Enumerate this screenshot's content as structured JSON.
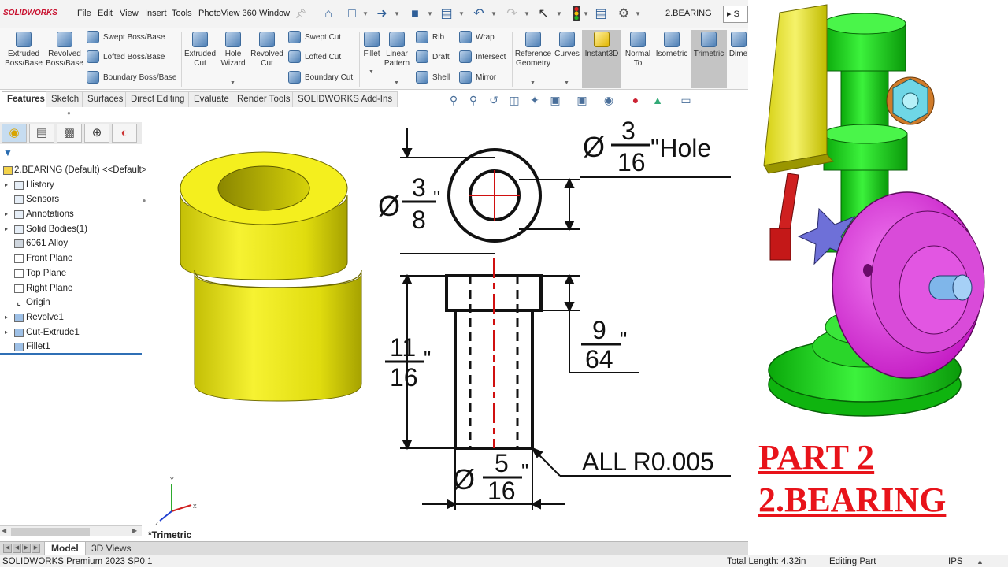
{
  "app": {
    "logo_text": "SOLIDWORKS",
    "menu": [
      "File",
      "Edit",
      "View",
      "Insert",
      "Tools",
      "PhotoView 360",
      "Window"
    ],
    "pin_icon": "pin-icon",
    "document_title": "2.BEARING",
    "search_text": "S",
    "quick_access_icons": [
      "home-icon",
      "new-document-icon",
      "open-icon",
      "save-icon",
      "print-icon",
      "undo-icon",
      "redo-icon",
      "select-icon",
      "rebuild-icon",
      "file-properties-icon",
      "options-icon"
    ]
  },
  "ribbon": {
    "extruded_boss": "Extruded\nBoss/Base",
    "revolved_boss": "Revolved\nBoss/Base",
    "swept_boss": "Swept Boss/Base",
    "lofted_boss": "Lofted Boss/Base",
    "boundary_boss": "Boundary Boss/Base",
    "extruded_cut": "Extruded\nCut",
    "hole_wizard": "Hole\nWizard",
    "revolved_cut": "Revolved\nCut",
    "swept_cut": "Swept Cut",
    "lofted_cut": "Lofted Cut",
    "boundary_cut": "Boundary Cut",
    "fillet": "Fillet",
    "linear_pattern": "Linear\nPattern",
    "rib": "Rib",
    "draft": "Draft",
    "shell": "Shell",
    "wrap": "Wrap",
    "intersect": "Intersect",
    "mirror": "Mirror",
    "reference_geometry": "Reference\nGeometry",
    "curves": "Curves",
    "instant3d": "Instant3D",
    "normal_to": "Normal\nTo",
    "isometric": "Isometric",
    "trimetric": "Trimetric",
    "dimetric": "Dime"
  },
  "command_tabs": [
    "Features",
    "Sketch",
    "Surfaces",
    "Direct Editing",
    "Evaluate",
    "Render Tools",
    "SOLIDWORKS Add-Ins"
  ],
  "view_toolbar_icons": [
    "zoom-to-fit-icon",
    "zoom-to-area-icon",
    "previous-view-icon",
    "section-view-icon",
    "dynamic-annotation-icon",
    "view-orientation-icon",
    "display-style-icon",
    "hide-show-icon",
    "edit-appearance-icon",
    "apply-scene-icon",
    "view-settings-icon"
  ],
  "feature_manager": {
    "tab_icons": [
      "feature-manager-icon",
      "property-manager-icon",
      "configuration-manager-icon",
      "dimxpert-icon",
      "display-manager-icon"
    ],
    "root": "2.BEARING (Default) <<Default>",
    "items": [
      {
        "label": "History",
        "icon": "history-icon",
        "expandable": true
      },
      {
        "label": "Sensors",
        "icon": "sensors-icon",
        "expandable": false
      },
      {
        "label": "Annotations",
        "icon": "annotations-icon",
        "expandable": true
      },
      {
        "label": "Solid Bodies(1)",
        "icon": "solid-bodies-icon",
        "expandable": true
      },
      {
        "label": "6061 Alloy",
        "icon": "material-icon",
        "expandable": false
      },
      {
        "label": "Front Plane",
        "icon": "plane-icon",
        "expandable": false
      },
      {
        "label": "Top Plane",
        "icon": "plane-icon",
        "expandable": false
      },
      {
        "label": "Right Plane",
        "icon": "plane-icon",
        "expandable": false
      },
      {
        "label": "Origin",
        "icon": "origin-icon",
        "expandable": false
      },
      {
        "label": "Revolve1",
        "icon": "revolve-icon",
        "expandable": true
      },
      {
        "label": "Cut-Extrude1",
        "icon": "cut-extrude-icon",
        "expandable": true
      },
      {
        "label": "Fillet1",
        "icon": "fillet-icon",
        "expandable": false
      }
    ]
  },
  "drawing": {
    "hole_dia": "3/16\"Hole",
    "hole_num": "3",
    "hole_den": "16",
    "hole_suffix": "\"Hole",
    "outer_num": "3",
    "outer_den": "8",
    "height_num": "11",
    "height_den": "16",
    "head_num": "9",
    "head_den": "64",
    "shank_num": "5",
    "shank_den": "16",
    "inch_mark": "\"",
    "diameter_symbol": "Ø",
    "fillet_note": "ALL R0.005",
    "triad_labels": [
      "X",
      "Y",
      "Z"
    ]
  },
  "view_label": "*Trimetric",
  "bottom_tabs": [
    "Model",
    "3D Views"
  ],
  "status": {
    "product": "SOLIDWORKS Premium 2023 SP0.1",
    "total_length": "Total Length: 4.32in",
    "mode": "Editing Part",
    "units": "IPS"
  },
  "caption": {
    "line1": "PART 2",
    "line2": "2.BEARING",
    "color": "#e8131a"
  },
  "colors": {
    "bearing": "#f2ee1a",
    "frame_green": "#1ee01e",
    "flywheel": "#e63ce6",
    "dimension_red": "#d01010"
  }
}
